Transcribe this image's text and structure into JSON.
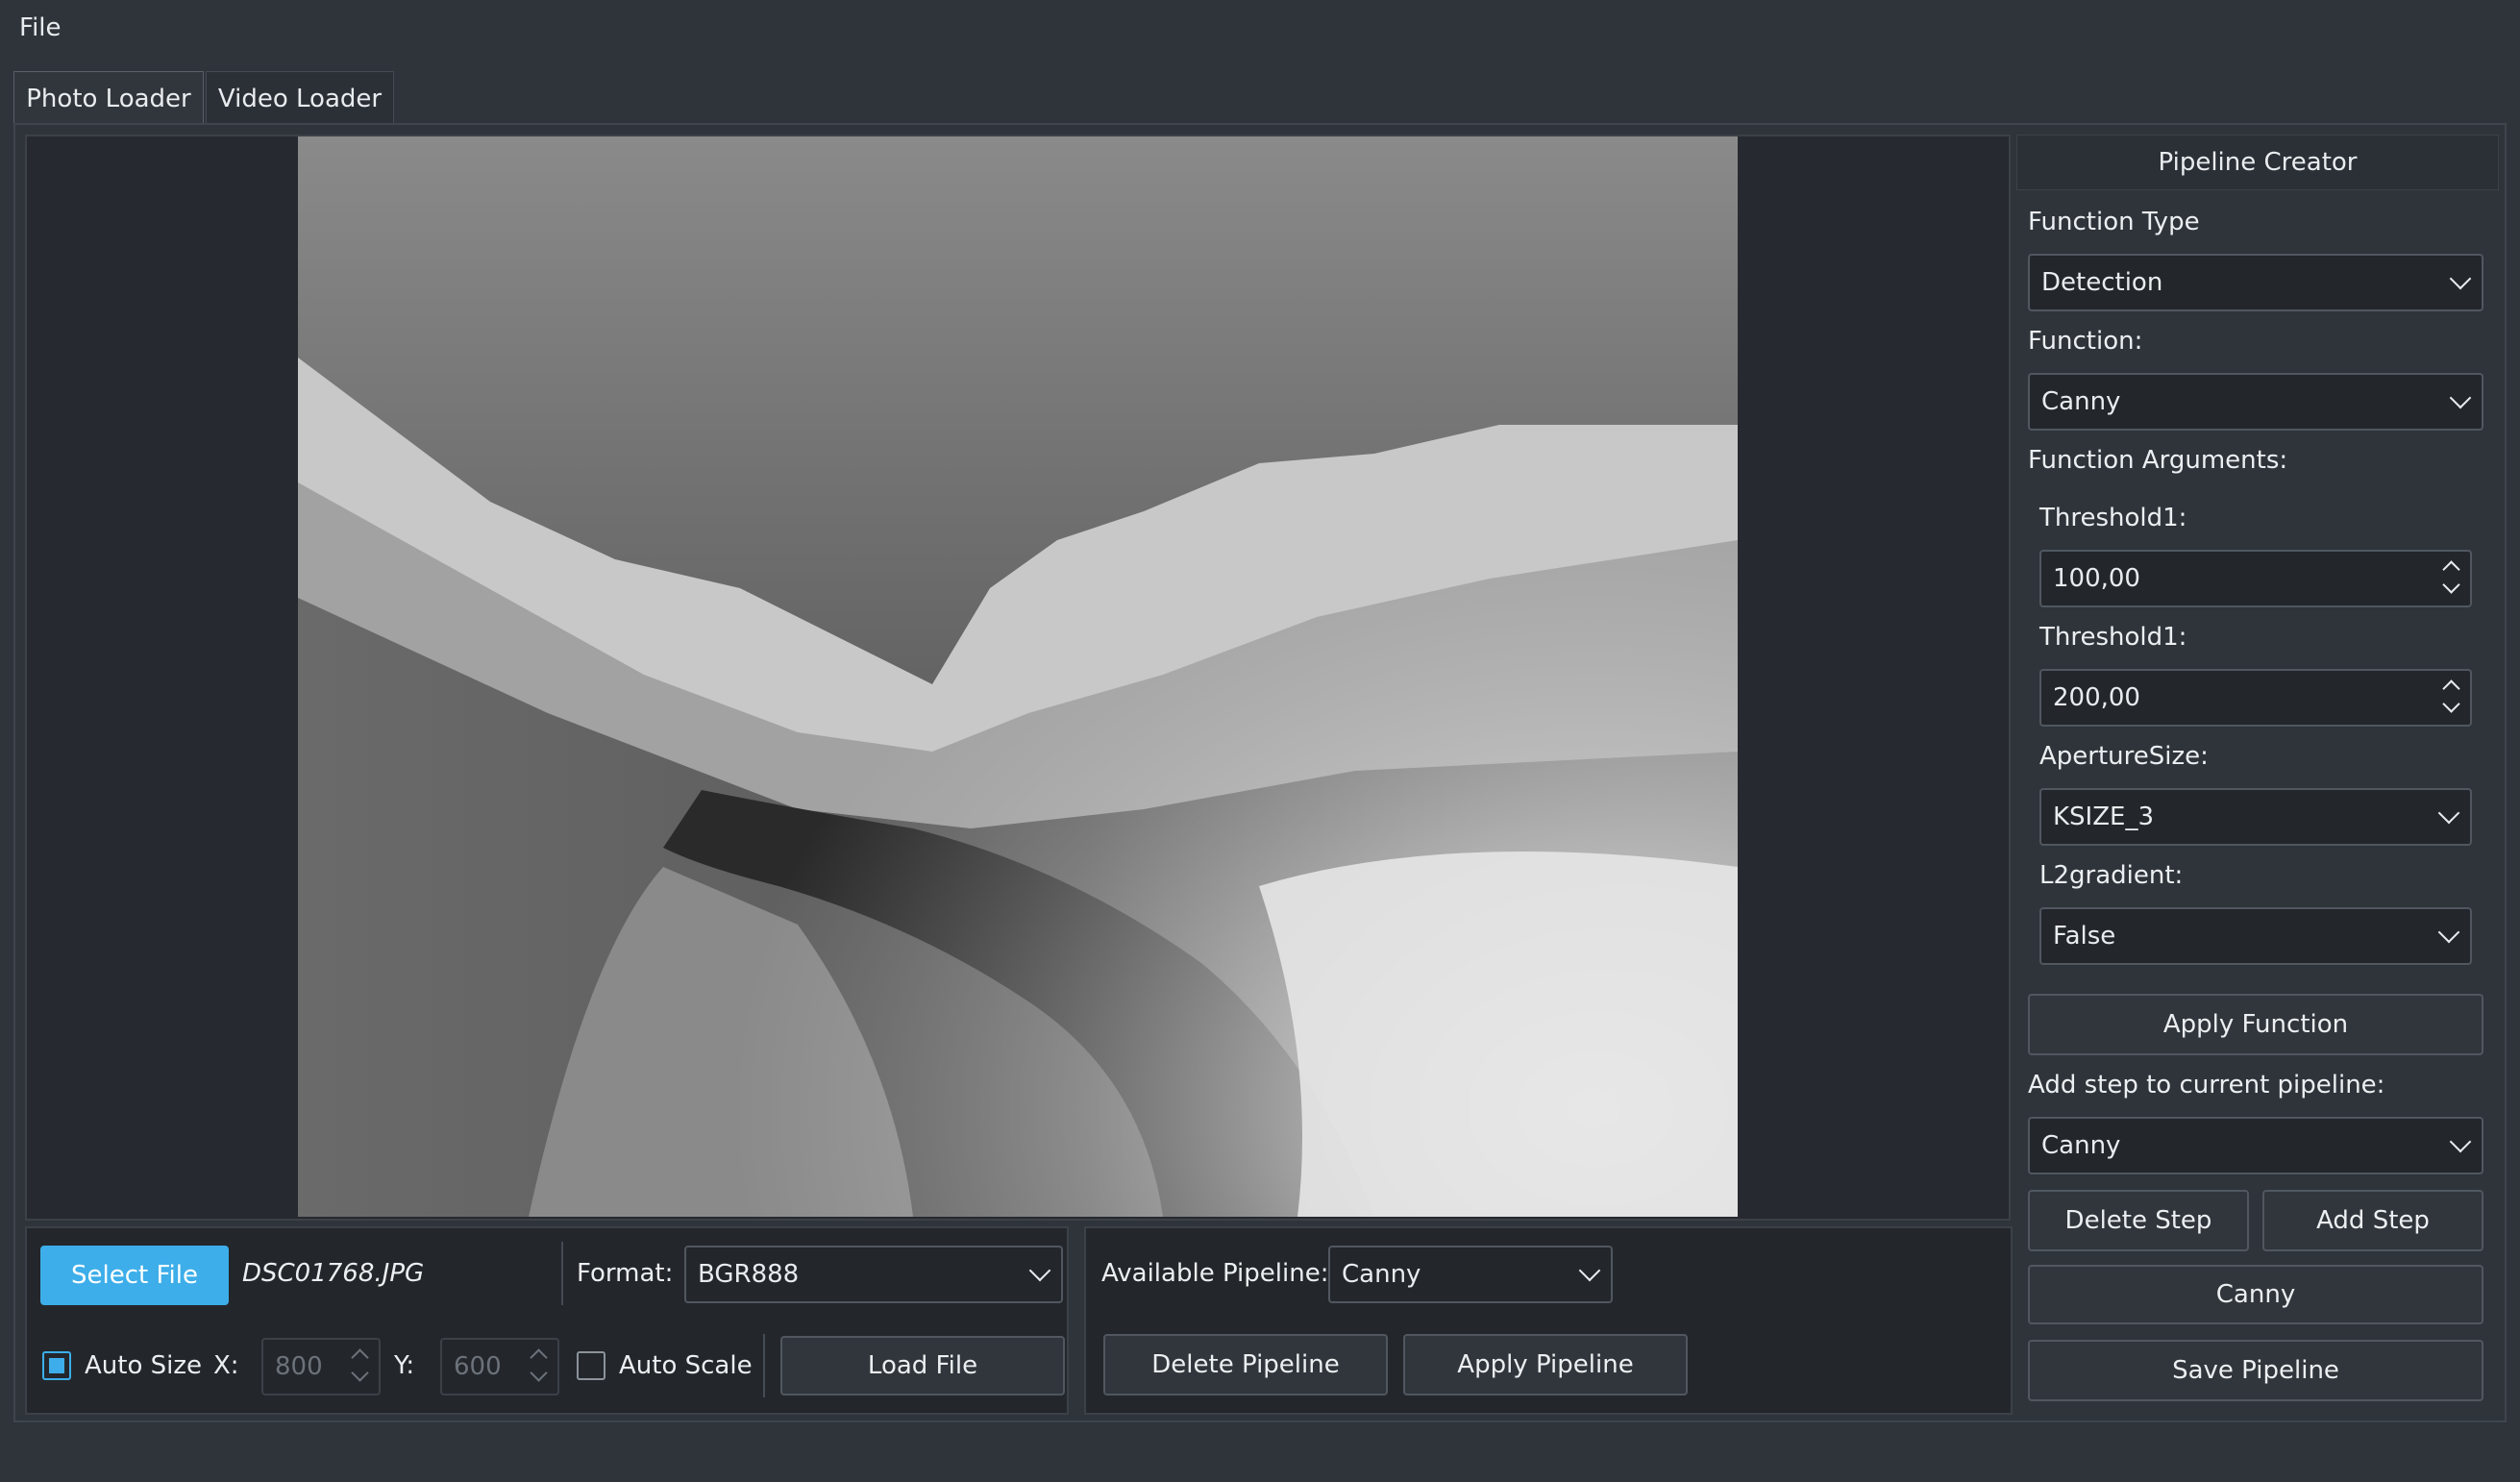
{
  "menu": {
    "file": "File"
  },
  "tabs": [
    {
      "label": "Photo Loader",
      "active": true
    },
    {
      "label": "Video Loader",
      "active": false
    }
  ],
  "controls": {
    "select_file": "Select File",
    "file_name": "DSC01768.JPG",
    "format_label": "Format:",
    "format_value": "BGR888",
    "auto_size_label": "Auto Size",
    "auto_size_checked": true,
    "x_label": "X:",
    "x_value": "800",
    "y_label": "Y:",
    "y_value": "600",
    "auto_scale_label": "Auto Scale",
    "auto_scale_checked": false,
    "load_file": "Load File"
  },
  "pipeline": {
    "available_label": "Available Pipeline:",
    "available_value": "Canny",
    "delete_pipeline": "Delete Pipeline",
    "apply_pipeline": "Apply Pipeline"
  },
  "creator": {
    "title": "Pipeline Creator",
    "function_type_label": "Function Type",
    "function_type_value": "Detection",
    "function_label": "Function:",
    "function_value": "Canny",
    "args_label": "Function Arguments:",
    "threshold1_label": "Threshold1:",
    "threshold1_value": "100,00",
    "threshold2_label": "Threshold1:",
    "threshold2_value": "200,00",
    "aperture_label": "ApertureSize:",
    "aperture_value": "KSIZE_3",
    "l2_label": "L2gradient:",
    "l2_value": "False",
    "apply_function": "Apply Function",
    "add_step_label": "Add step to current pipeline:",
    "add_step_value": "Canny",
    "delete_step": "Delete Step",
    "add_step": "Add Step",
    "step_item": "Canny",
    "save_pipeline": "Save Pipeline"
  },
  "colors": {
    "background": "#2f343b",
    "accent": "#3daee9",
    "panel": "#23272c"
  }
}
